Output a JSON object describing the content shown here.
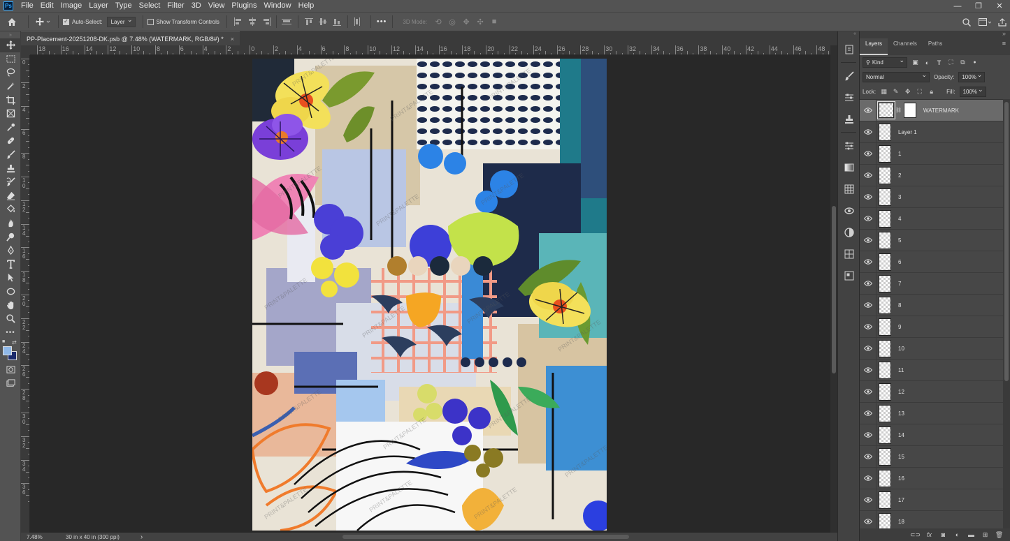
{
  "app": {
    "logo": "Ps",
    "menu": [
      "File",
      "Edit",
      "Image",
      "Layer",
      "Type",
      "Select",
      "Filter",
      "3D",
      "View",
      "Plugins",
      "Window",
      "Help"
    ],
    "window_controls": [
      "minimize-icon",
      "restore-icon",
      "close-icon"
    ]
  },
  "options_bar": {
    "auto_select_label": "Auto-Select:",
    "auto_select_checked": true,
    "auto_select_target": "Layer",
    "show_transform_label": "Show Transform Controls",
    "show_transform_checked": false,
    "mode_3d_label": "3D Mode:",
    "more_label": "•••"
  },
  "document": {
    "tab_title": "PP-Placement-20251208-DK.psb @ 7.48% (WATERMARK, RGB/8#) *",
    "close_glyph": "×",
    "watermark_text": "PRINT&PALETTE"
  },
  "rulers": {
    "top_labels": [
      "18",
      "16",
      "14",
      "12",
      "10",
      "8",
      "6",
      "4",
      "2",
      "0",
      "2",
      "4",
      "6",
      "8",
      "10",
      "12",
      "14",
      "16",
      "18",
      "20",
      "22",
      "24",
      "26",
      "28",
      "30",
      "32",
      "34",
      "36",
      "38",
      "40",
      "42",
      "44",
      "46",
      "48"
    ],
    "left_labels": [
      "0",
      "2",
      "4",
      "6",
      "8",
      "10",
      "12",
      "14",
      "16",
      "18",
      "20",
      "22",
      "24",
      "26",
      "28",
      "30",
      "32",
      "34",
      "36"
    ]
  },
  "status": {
    "zoom": "7.48%",
    "doc_size": "30 in x 40 in (300 ppi)",
    "arrow": "›"
  },
  "layers_panel": {
    "tabs": [
      "Layers",
      "Channels",
      "Paths"
    ],
    "active_tab": "Layers",
    "filter_kind": "Kind",
    "blend_mode": "Normal",
    "opacity_label": "Opacity:",
    "opacity_value": "100%",
    "lock_label": "Lock:",
    "fill_label": "Fill:",
    "fill_value": "100%",
    "layers": [
      {
        "name": "WATERMARK",
        "selected": true
      },
      {
        "name": "Layer 1"
      },
      {
        "name": "1"
      },
      {
        "name": "2"
      },
      {
        "name": "3"
      },
      {
        "name": "4"
      },
      {
        "name": "5"
      },
      {
        "name": "6"
      },
      {
        "name": "7"
      },
      {
        "name": "8"
      },
      {
        "name": "9"
      },
      {
        "name": "10"
      },
      {
        "name": "11"
      },
      {
        "name": "12"
      },
      {
        "name": "13"
      },
      {
        "name": "14"
      },
      {
        "name": "15"
      },
      {
        "name": "16"
      },
      {
        "name": "17"
      },
      {
        "name": "18"
      }
    ],
    "footer_icons": [
      "link-layers-icon",
      "fx-icon",
      "mask-icon",
      "adjustment-icon",
      "group-folder-icon",
      "new-layer-icon",
      "trash-icon"
    ]
  },
  "colors": {
    "foreground": "#8fb8e8",
    "background": "#1a2a6c"
  }
}
